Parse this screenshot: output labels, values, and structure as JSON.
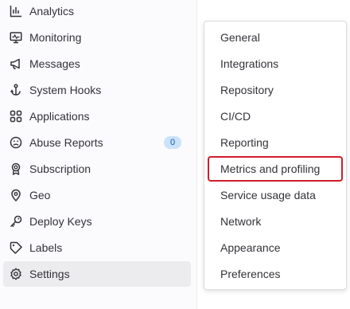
{
  "sidebar": {
    "items": [
      {
        "label": "Analytics",
        "icon": "chart-icon"
      },
      {
        "label": "Monitoring",
        "icon": "monitor-icon"
      },
      {
        "label": "Messages",
        "icon": "bullhorn-icon"
      },
      {
        "label": "System Hooks",
        "icon": "hook-icon"
      },
      {
        "label": "Applications",
        "icon": "applications-icon"
      },
      {
        "label": "Abuse Reports",
        "icon": "abuse-icon",
        "badge": "0"
      },
      {
        "label": "Subscription",
        "icon": "license-icon"
      },
      {
        "label": "Geo",
        "icon": "location-icon"
      },
      {
        "label": "Deploy Keys",
        "icon": "key-icon"
      },
      {
        "label": "Labels",
        "icon": "label-icon"
      },
      {
        "label": "Settings",
        "icon": "settings-icon",
        "active": true
      }
    ]
  },
  "flyout": {
    "items": [
      {
        "label": "General"
      },
      {
        "label": "Integrations"
      },
      {
        "label": "Repository"
      },
      {
        "label": "CI/CD"
      },
      {
        "label": "Reporting"
      },
      {
        "label": "Metrics and profiling",
        "highlighted": true
      },
      {
        "label": "Service usage data"
      },
      {
        "label": "Network"
      },
      {
        "label": "Appearance"
      },
      {
        "label": "Preferences"
      }
    ]
  },
  "colors": {
    "highlight_border": "#d11c2a",
    "active_bg": "#ececef",
    "badge_bg": "#cbe2f9",
    "badge_text": "#0b5cad"
  }
}
